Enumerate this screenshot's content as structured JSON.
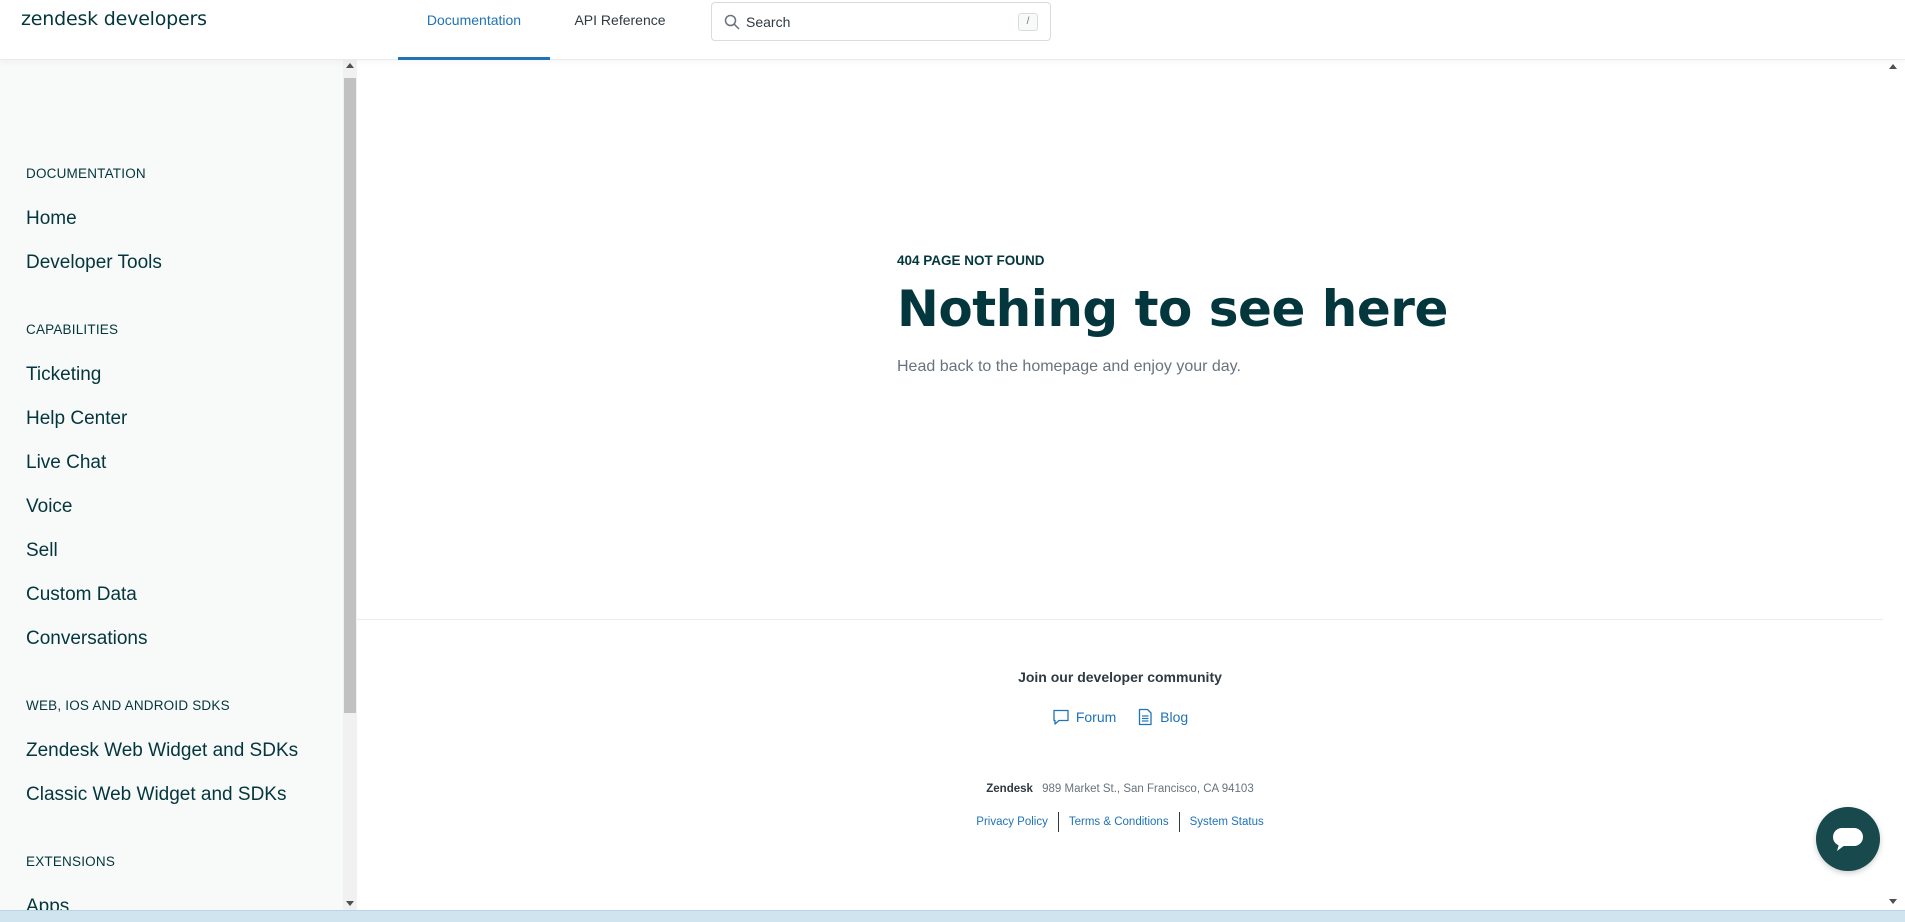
{
  "header": {
    "logo": "zendesk developers",
    "tabs": [
      {
        "label": "Documentation",
        "active": true
      },
      {
        "label": "API Reference",
        "active": false
      }
    ],
    "search": {
      "placeholder": "Search",
      "shortcut": "/"
    }
  },
  "sidebar": {
    "sections": [
      {
        "title": "DOCUMENTATION",
        "items": [
          "Home",
          "Developer Tools"
        ]
      },
      {
        "title": "CAPABILITIES",
        "items": [
          "Ticketing",
          "Help Center",
          "Live Chat",
          "Voice",
          "Sell",
          "Custom Data",
          "Conversations"
        ]
      },
      {
        "title": "WEB, IOS AND ANDROID SDKS",
        "items": [
          "Zendesk Web Widget and SDKs",
          "Classic Web Widget and SDKs"
        ]
      },
      {
        "title": "EXTENSIONS",
        "items": [
          "Apps"
        ]
      }
    ]
  },
  "main": {
    "error_code": "404 PAGE NOT FOUND",
    "title": "Nothing to see here",
    "description": "Head back to the homepage and enjoy your day."
  },
  "footer": {
    "community_heading": "Join our developer community",
    "forum_label": "Forum",
    "blog_label": "Blog",
    "company": "Zendesk",
    "address": "989 Market St., San Francisco, CA 94103",
    "legal": [
      "Privacy Policy",
      "Terms & Conditions",
      "System Status"
    ]
  },
  "colors": {
    "accent": "#1f73b7",
    "heading": "#03363d",
    "sidebar_bg": "#f8f9f9",
    "chat_button": "#17494d"
  },
  "icons": {
    "search": "search-icon",
    "forum": "speech-bubble-icon",
    "blog": "document-icon",
    "chat": "chat-icon"
  }
}
